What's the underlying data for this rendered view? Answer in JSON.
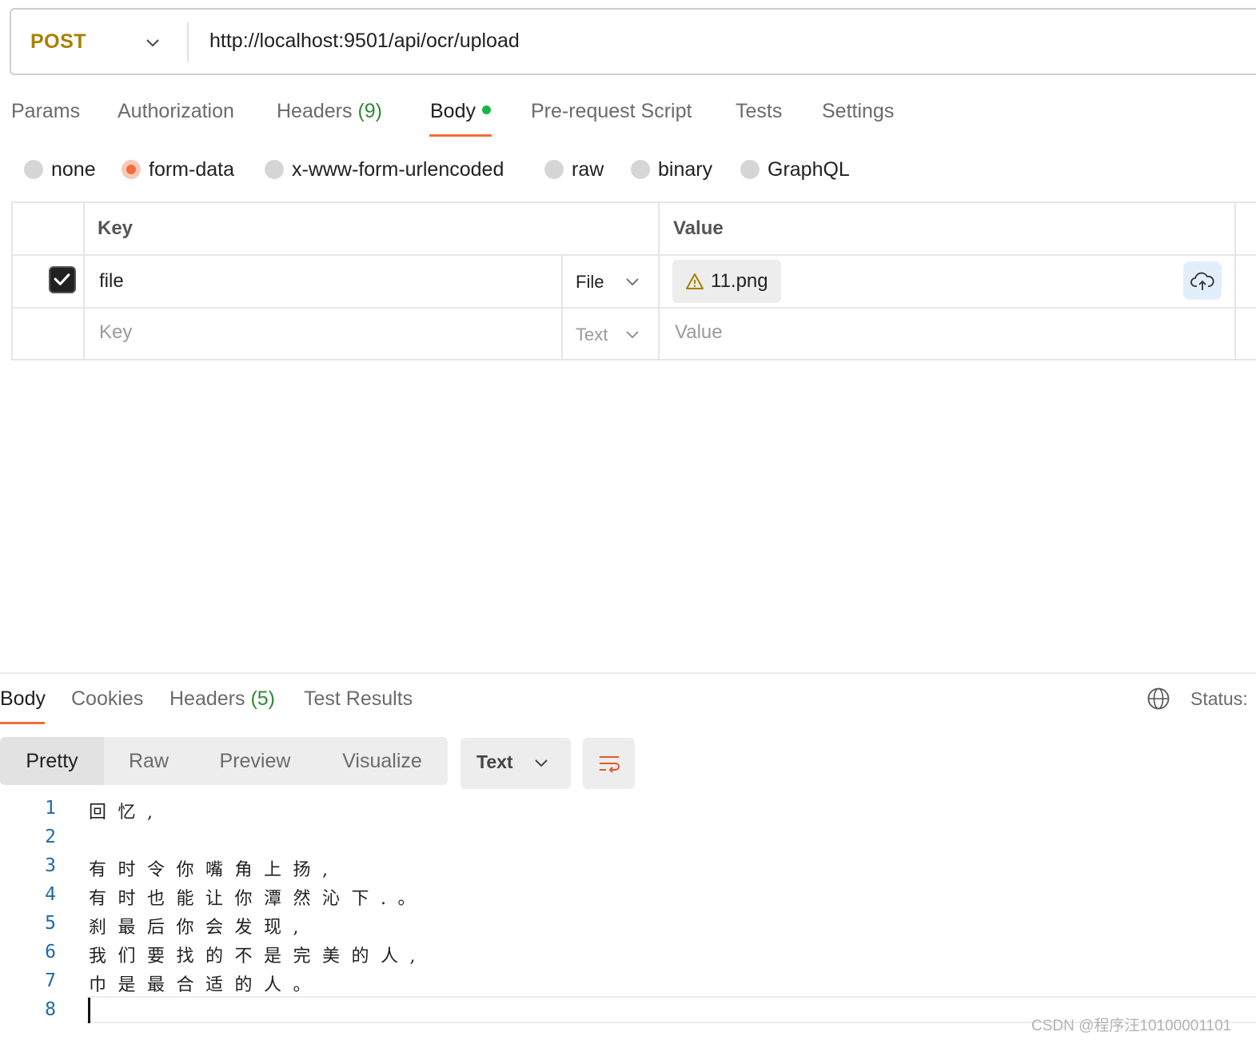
{
  "request": {
    "method": "POST",
    "url": "http://localhost:9501/api/ocr/upload"
  },
  "request_tabs": {
    "params": "Params",
    "authorization": "Authorization",
    "headers": "Headers",
    "headers_count": "(9)",
    "body": "Body",
    "pre_request": "Pre-request Script",
    "tests": "Tests",
    "settings": "Settings"
  },
  "body_types": {
    "none": "none",
    "form_data": "form-data",
    "urlencoded": "x-www-form-urlencoded",
    "raw": "raw",
    "binary": "binary",
    "graphql": "GraphQL",
    "selected": "form-data"
  },
  "form_table": {
    "key_header": "Key",
    "value_header": "Value",
    "rows": [
      {
        "checked": true,
        "key": "file",
        "type": "File",
        "value": "11.png"
      }
    ],
    "new_row": {
      "key_placeholder": "Key",
      "type": "Text",
      "value_placeholder": "Value"
    }
  },
  "response_tabs": {
    "body": "Body",
    "cookies": "Cookies",
    "headers": "Headers",
    "headers_count": "(5)",
    "test_results": "Test Results",
    "status_label": "Status:"
  },
  "view_modes": {
    "pretty": "Pretty",
    "raw": "Raw",
    "preview": "Preview",
    "visualize": "Visualize",
    "format": "Text"
  },
  "response_lines": [
    {
      "n": "1",
      "text": "回忆,"
    },
    {
      "n": "2",
      "text": ""
    },
    {
      "n": "3",
      "text": "有时令你嘴角上扬,"
    },
    {
      "n": "4",
      "text": "有时也能让你潭然沁下.。"
    },
    {
      "n": "5",
      "text": "刹最后你会发现,"
    },
    {
      "n": "6",
      "text": "我们要找的不是完美的人,"
    },
    {
      "n": "7",
      "text": "巾是最合适的人。"
    },
    {
      "n": "8",
      "text": ""
    }
  ],
  "watermark": "CSDN @程序汪10100001101",
  "icons": [
    "chevron-down-icon",
    "warning-icon",
    "cloud-upload-icon",
    "globe-icon",
    "wrap-lines-icon",
    "checkmark-icon"
  ],
  "colors": {
    "method": "#a97f00",
    "accent": "#f26b3a",
    "count_green": "#2f8a3a",
    "body_dot": "#12b84a",
    "line_numbers": "#1f6aa8"
  }
}
